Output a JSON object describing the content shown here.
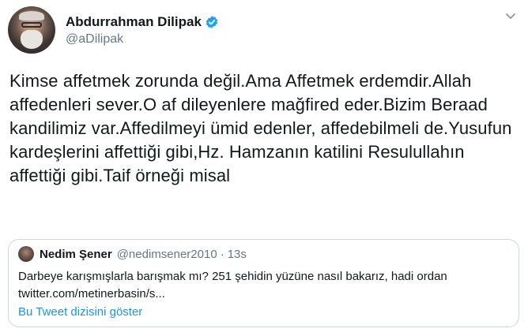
{
  "author": {
    "display_name": "Abdurrahman Dilipak",
    "handle": "@aDilipak",
    "verified": true
  },
  "tweet_text": "Kimse affetmek zorunda değil.Ama Affetmek erdemdir.Allah affedenleri sever.O af dileyenlere mağfired eder.Bizim Beraad kandilimiz var.Affedilmeyi ümid edenler, affedebilmeli de.Yusufun kardeşlerini affettiği gibi,Hz. Hamzanın katilini Resulullahın affettiği gibi.Taif örneği misal",
  "quoted_tweet": {
    "display_name": "Nedim Şener",
    "handle": "@nedimsener2010",
    "separator": "·",
    "time": "13s",
    "text_line1": "Darbeye karışmışlarla barışmak mı? 251 şehidin yüzüne nasıl bakarız, hadi ordan",
    "text_line2": "twitter.com/metinerbasin/s...",
    "thread_link": "Bu Tweet dizisini göster"
  },
  "icons": {
    "verified": "verified-badge-icon",
    "menu": "chevron-down-icon"
  },
  "colors": {
    "accent": "#1da1f2",
    "link": "#1b95e0",
    "secondary_text": "#657786",
    "border": "#ccd6dd"
  }
}
